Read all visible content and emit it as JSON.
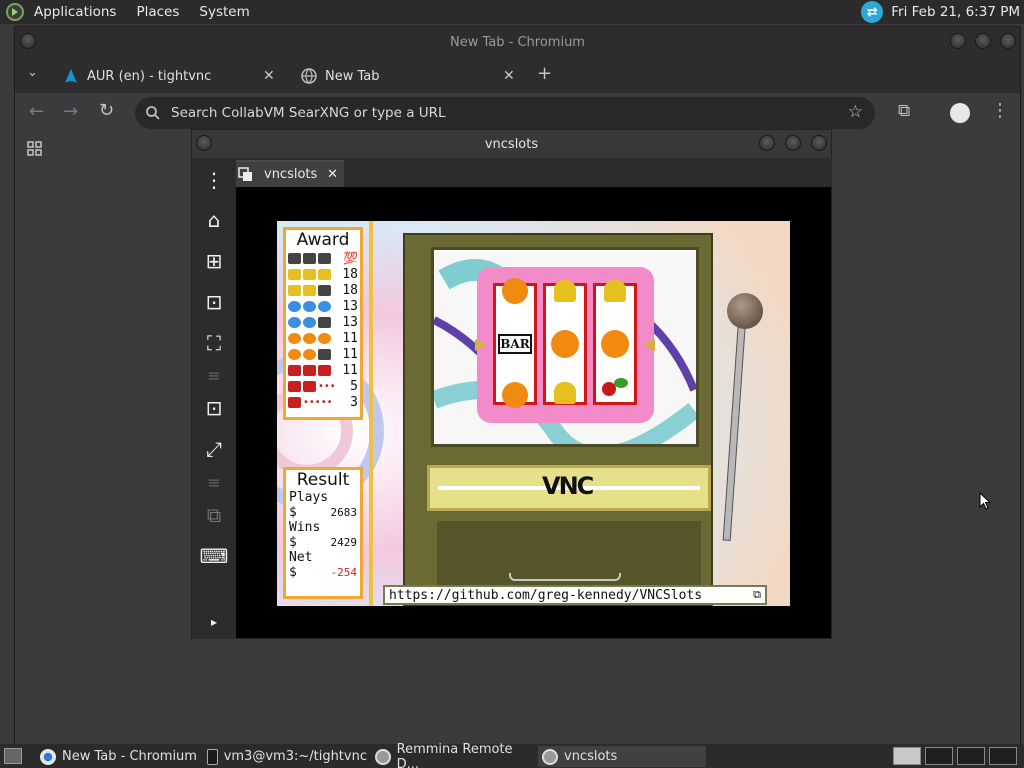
{
  "top_panel": {
    "menus": [
      "Applications",
      "Places",
      "System"
    ],
    "clock": "Fri Feb 21,  6:37 PM"
  },
  "chrome": {
    "window_title": "New Tab - Chromium",
    "tabs": [
      {
        "label": "AUR (en) - tightvnc",
        "icon": "arch-linux-icon"
      },
      {
        "label": "New Tab",
        "icon": "globe-icon"
      }
    ],
    "omnibox_placeholder": "Search CollabVM SearXNG or type a URL"
  },
  "remmina": {
    "window_title": "vncslots",
    "tab_label": "vncslots",
    "toolbar_icons": [
      "menu-icon",
      "home-icon",
      "new-connection-icon",
      "fit-window-icon",
      "fullscreen-icon",
      "divider",
      "scaled-mode-icon",
      "dynamic-resolution-icon",
      "divider",
      "minimize-icon",
      "keyboard-icon",
      "expand-icon"
    ]
  },
  "slots": {
    "award_title": "Award",
    "award_rows": [
      {
        "symbols": "bar bar bar",
        "value": "💯"
      },
      {
        "symbols": "bell bell bell",
        "value": "18"
      },
      {
        "symbols": "bell bell bar",
        "value": "18"
      },
      {
        "symbols": "plum plum plum",
        "value": "13"
      },
      {
        "symbols": "plum plum bar",
        "value": "13"
      },
      {
        "symbols": "orange orange orange",
        "value": "11"
      },
      {
        "symbols": "orange orange bar",
        "value": "11"
      },
      {
        "symbols": "cherry cherry cherry",
        "value": "11"
      },
      {
        "symbols": "cherry cherry any",
        "value": "5"
      },
      {
        "symbols": "cherry any any",
        "value": "3"
      }
    ],
    "result_title": "Result",
    "plays_label": "Plays",
    "plays_value": "2683",
    "wins_label": "Wins",
    "wins_value": "2429",
    "net_label": "Net",
    "net_value": "-254",
    "currency": "$",
    "reels": [
      [
        "orange",
        "bar",
        "orange"
      ],
      [
        "bell",
        "orange",
        "bell"
      ],
      [
        "bell",
        "orange",
        "cherry"
      ]
    ],
    "bar_text": "BAR",
    "logo_text": "VNC",
    "url": "https://github.com/greg-kennedy/VNCSlots"
  },
  "taskbar": {
    "tasks": [
      {
        "label": "New Tab - Chromium",
        "icon": "chromium-icon"
      },
      {
        "label": "vm3@vm3:~/tightvnc",
        "icon": "terminal-icon"
      },
      {
        "label": "Remmina Remote D...",
        "icon": "remmina-icon"
      },
      {
        "label": "vncslots",
        "icon": "remmina-icon"
      }
    ]
  },
  "colors": {
    "panel_bg": "#2b2b2b",
    "chrome_bg": "#3b3b3d",
    "award_border": "#f0a830",
    "reel_border": "#d01818",
    "negative": "#d02020"
  }
}
